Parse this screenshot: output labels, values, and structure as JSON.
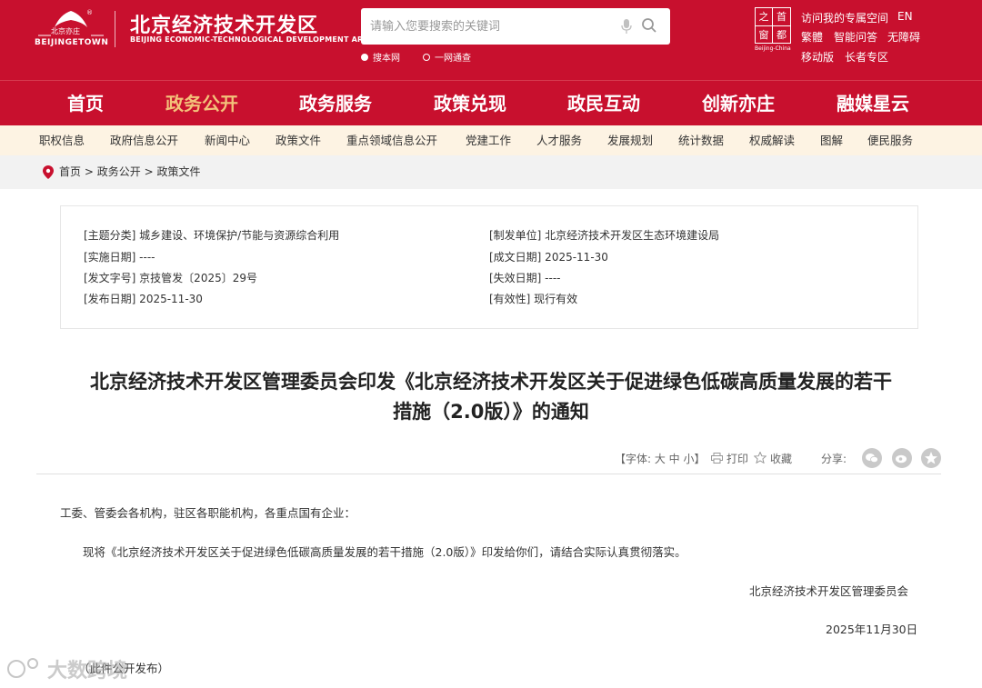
{
  "header": {
    "logo_emblem_text": "北京亦庄",
    "logo_town": "BEIJINGETOWN",
    "title": "北京经济技术开发区",
    "subtitle": "BEIJING ECONOMIC-TECHNOLOGICAL DEVELOPMENT AREA",
    "search_placeholder": "请输入您要搜索的关键词",
    "scope_site": "搜本网",
    "scope_all": "一网通查",
    "capital_chars": [
      "首",
      "都",
      "之",
      "窗"
    ],
    "capital_sub": "Beijing-China",
    "links": {
      "space": "访问我的专属空间",
      "en": "EN",
      "trad": "繁體",
      "qa": "智能问答",
      "access": "无障碍",
      "mobile": "移动版",
      "elder": "长者专区"
    }
  },
  "mainnav": [
    "首页",
    "政务公开",
    "政务服务",
    "政策兑现",
    "政民互动",
    "创新亦庄",
    "融媒星云"
  ],
  "subnav": [
    "职权信息",
    "政府信息公开",
    "新闻中心",
    "政策文件",
    "重点领域信息公开",
    "党建工作",
    "人才服务",
    "发展规划",
    "统计数据",
    "权威解读",
    "图解",
    "便民服务"
  ],
  "breadcrumb": [
    "首页",
    "政务公开",
    "政策文件"
  ],
  "breadcrumb_sep": ">",
  "info": {
    "category": "[主题分类] 城乡建设、环境保护/节能与资源综合利用",
    "issuer": "[制发单位] 北京经济技术开发区生态环境建设局",
    "effective": "[实施日期] ----",
    "written": "[成文日期] 2025-11-30",
    "docno": "[发文字号] 京技管发〔2025〕29号",
    "expire": "[失效日期] ----",
    "published": "[发布日期] 2025-11-30",
    "validity": "[有效性] 现行有效"
  },
  "doc": {
    "title_line1": "北京经济技术开发区管理委员会印发《北京经济技术开发区关于促进绿色低碳高质量发展的若干",
    "title_line2": "措施（2.0版）》的通知",
    "font_label": "【字体: 大 中 小】",
    "print": "打印",
    "fav": "收藏",
    "share": "分享:",
    "salutation": "工委、管委会各机构，驻区各职能机构，各重点国有企业：",
    "body": "现将《北京经济技术开发区关于促进绿色低碳高质量发展的若干措施（2.0版）》印发给你们，请结合实际认真贯彻落实。",
    "signature": "北京经济技术开发区管理委员会",
    "date": "2025年11月30日",
    "note": "（此件公开发布）"
  },
  "watermark": "大数跨境",
  "colors": {
    "brand_red": "#c8102e",
    "nav_active": "#f3c27a",
    "subnav_bg": "#fdf3e3"
  }
}
